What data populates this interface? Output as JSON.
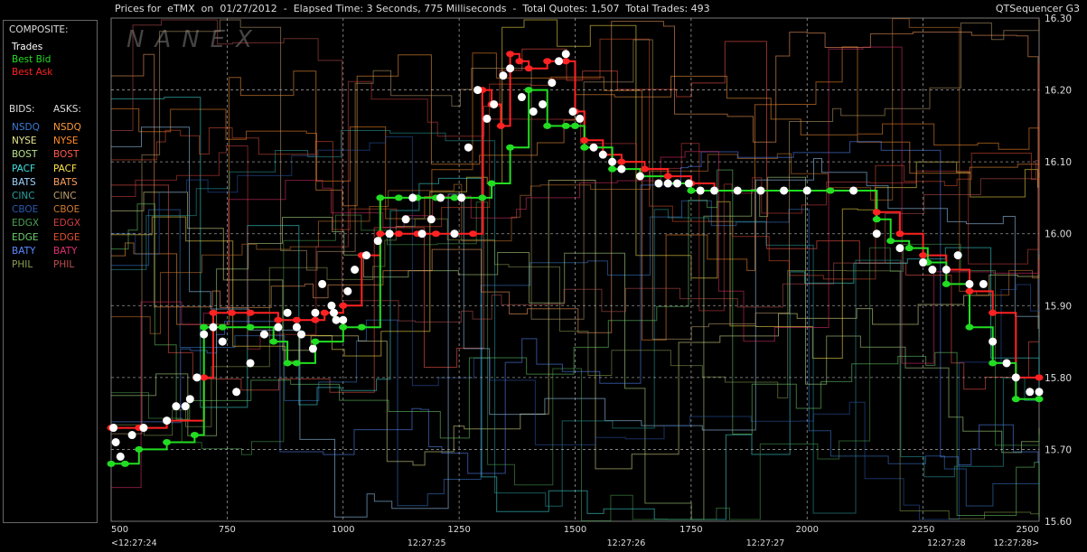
{
  "header": {
    "title": "Prices for  eTMX  on  01/27/2012  -  Elapsed Time: 3 Seconds, 775 Milliseconds  -  Total Quotes: 1,507  Total Trades: 493",
    "right": "QTSequencer G3"
  },
  "watermark": "NANEX",
  "legend": {
    "composite_label": "COMPOSITE:",
    "composite_items": [
      {
        "label": "Trades",
        "color": "#ffffff"
      },
      {
        "label": "Best Bid",
        "color": "#22dd22"
      },
      {
        "label": "Best Ask",
        "color": "#ff2222"
      }
    ],
    "bids_label": "BIDS:",
    "asks_label": "ASKS:",
    "exchanges": [
      {
        "bid": "NSDQ",
        "ask": "NSDQ",
        "bid_color": "#3a7bd5",
        "ask_color": "#ff9a3c"
      },
      {
        "bid": "NYSE",
        "ask": "NYSE",
        "bid_color": "#e6e690",
        "ask_color": "#ff8c2a"
      },
      {
        "bid": "BOST",
        "ask": "BOST",
        "bid_color": "#b5e28a",
        "ask_color": "#ff5a4a"
      },
      {
        "bid": "PACF",
        "ask": "PACF",
        "bid_color": "#40e0e0",
        "ask_color": "#ffe44a"
      },
      {
        "bid": "BATS",
        "ask": "BATS",
        "bid_color": "#9fd4ff",
        "ask_color": "#ffa060"
      },
      {
        "bid": "CINC",
        "ask": "CINC",
        "bid_color": "#2aa0a0",
        "ask_color": "#c0a070"
      },
      {
        "bid": "CBOE",
        "ask": "CBOE",
        "bid_color": "#2a5ab0",
        "ask_color": "#d07a30"
      },
      {
        "bid": "EDGX",
        "ask": "EDGX",
        "bid_color": "#4aa050",
        "ask_color": "#d04040"
      },
      {
        "bid": "EDGE",
        "ask": "EDGE",
        "bid_color": "#6ad06a",
        "ask_color": "#e05030"
      },
      {
        "bid": "BATY",
        "ask": "BATY",
        "bid_color": "#5a8aff",
        "ask_color": "#e03070"
      },
      {
        "bid": "PHIL",
        "ask": "PHIL",
        "bid_color": "#8aa050",
        "ask_color": "#c05050"
      }
    ]
  },
  "chart_data": {
    "type": "line",
    "title": "Prices for  eTMX  on  01/27/2012",
    "xlabel": "",
    "ylabel": "",
    "xlim": [
      500,
      2500
    ],
    "ylim": [
      15.6,
      16.3
    ],
    "x_ticks": [
      "500",
      "750",
      "1000",
      "1250",
      "1500",
      "1750",
      "2000",
      "2250",
      "2500"
    ],
    "y_ticks": [
      "16.30",
      "16.20",
      "16.10",
      "16.00",
      "15.90",
      "15.80",
      "15.70",
      "15.60"
    ],
    "time_labels": [
      {
        "x": 500,
        "label": "<12:27:24"
      },
      {
        "x": 1180,
        "label": "12:27:25"
      },
      {
        "x": 1610,
        "label": "12:27:26"
      },
      {
        "x": 1910,
        "label": "12:27:27"
      },
      {
        "x": 2300,
        "label": "12:27:28"
      },
      {
        "x": 2500,
        "label": "12:27:28>"
      }
    ],
    "grid": true,
    "series": [
      {
        "name": "Best Ask",
        "color": "#ff2222",
        "x": [
          500,
          560,
          620,
          700,
          720,
          760,
          800,
          860,
          900,
          940,
          960,
          1000,
          1040,
          1080,
          1120,
          1160,
          1200,
          1240,
          1280,
          1300,
          1320,
          1340,
          1360,
          1380,
          1400,
          1440,
          1480,
          1500,
          1520,
          1560,
          1600,
          1650,
          1700,
          1750,
          1800,
          1850,
          1900,
          1950,
          2000,
          2050,
          2100,
          2150,
          2200,
          2250,
          2300,
          2350,
          2400,
          2450,
          2500
        ],
        "y": [
          15.73,
          15.73,
          15.74,
          15.8,
          15.89,
          15.89,
          15.89,
          15.88,
          15.88,
          15.88,
          15.89,
          15.9,
          15.97,
          16.0,
          16.0,
          16.0,
          16.0,
          16.0,
          16.0,
          16.2,
          16.18,
          16.15,
          16.25,
          16.24,
          16.23,
          16.24,
          16.24,
          16.17,
          16.13,
          16.11,
          16.1,
          16.09,
          16.08,
          16.07,
          16.06,
          16.06,
          16.06,
          16.06,
          16.06,
          16.06,
          16.06,
          16.03,
          16.0,
          15.97,
          15.95,
          15.92,
          15.89,
          15.8,
          15.8
        ]
      },
      {
        "name": "Best Bid",
        "color": "#22dd22",
        "x": [
          500,
          530,
          560,
          620,
          680,
          700,
          740,
          800,
          850,
          880,
          900,
          940,
          1000,
          1040,
          1080,
          1120,
          1160,
          1200,
          1240,
          1300,
          1320,
          1360,
          1400,
          1440,
          1480,
          1500,
          1520,
          1580,
          1640,
          1700,
          1750,
          1800,
          1850,
          1900,
          1950,
          2000,
          2050,
          2100,
          2150,
          2180,
          2220,
          2260,
          2300,
          2350,
          2400,
          2450,
          2500
        ],
        "y": [
          15.68,
          15.68,
          15.7,
          15.71,
          15.72,
          15.87,
          15.87,
          15.87,
          15.85,
          15.82,
          15.82,
          15.85,
          15.87,
          15.87,
          16.05,
          16.05,
          16.05,
          16.05,
          16.05,
          16.05,
          16.07,
          16.12,
          16.2,
          16.15,
          16.15,
          16.15,
          16.12,
          16.09,
          16.08,
          16.07,
          16.06,
          16.06,
          16.06,
          16.06,
          16.06,
          16.06,
          16.06,
          16.06,
          16.02,
          15.99,
          15.98,
          15.96,
          15.93,
          15.87,
          15.82,
          15.77,
          15.77
        ]
      },
      {
        "name": "Trades",
        "color": "#ffffff",
        "x": [
          505,
          510,
          520,
          545,
          570,
          620,
          640,
          660,
          670,
          685,
          700,
          720,
          740,
          770,
          800,
          830,
          860,
          880,
          900,
          910,
          935,
          940,
          955,
          975,
          980,
          985,
          1000,
          1010,
          1025,
          1050,
          1075,
          1100,
          1135,
          1150,
          1170,
          1190,
          1210,
          1240,
          1255,
          1270,
          1290,
          1310,
          1325,
          1345,
          1360,
          1385,
          1410,
          1430,
          1450,
          1465,
          1480,
          1495,
          1510,
          1540,
          1560,
          1580,
          1600,
          1640,
          1680,
          1700,
          1720,
          1745,
          1770,
          1800,
          1850,
          1900,
          1950,
          2000,
          2100,
          2150,
          2200,
          2250,
          2270,
          2300,
          2325,
          2350,
          2380,
          2400,
          2430,
          2450,
          2480,
          2500
        ],
        "y": [
          15.73,
          15.71,
          15.69,
          15.72,
          15.73,
          15.74,
          15.76,
          15.76,
          15.77,
          15.8,
          15.86,
          15.87,
          15.85,
          15.78,
          15.82,
          15.86,
          15.87,
          15.89,
          15.87,
          15.86,
          15.84,
          15.89,
          15.93,
          15.9,
          15.89,
          15.88,
          15.88,
          15.92,
          15.95,
          15.97,
          15.99,
          16.0,
          16.02,
          16.05,
          16.0,
          16.02,
          16.05,
          16.0,
          16.05,
          16.12,
          16.2,
          16.16,
          16.18,
          16.22,
          16.23,
          16.19,
          16.17,
          16.18,
          16.21,
          16.24,
          16.25,
          16.17,
          16.16,
          16.12,
          16.11,
          16.1,
          16.09,
          16.08,
          16.07,
          16.07,
          16.07,
          16.07,
          16.06,
          16.06,
          16.06,
          16.06,
          16.06,
          16.06,
          16.06,
          16.0,
          15.98,
          15.96,
          15.95,
          15.95,
          15.97,
          15.93,
          15.93,
          15.85,
          15.82,
          15.8,
          15.78,
          15.78
        ]
      }
    ]
  }
}
